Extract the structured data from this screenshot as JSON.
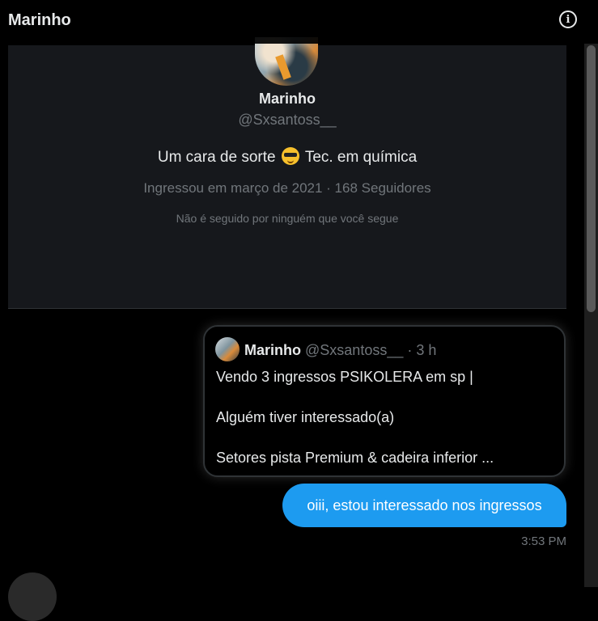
{
  "header": {
    "title": "Marinho",
    "info_icon": "info-icon"
  },
  "profile": {
    "name": "Marinho",
    "handle": "@Sxsantoss__",
    "bio_before": "Um cara de sorte",
    "bio_emoji": "smiling-face-with-sunglasses",
    "bio_after": "Tec. em química",
    "meta": "Ingressou em março de 2021 · 168 Seguidores",
    "follow_note": "Não é seguido por ninguém que você segue"
  },
  "quoted_post": {
    "name": "Marinho",
    "handle": "@Sxsantoss__",
    "separator": "·",
    "time": "3 h",
    "lines": [
      "Vendo 3 ingressos PSIKOLERA em sp |",
      "Alguém tiver interessado(a)",
      "Setores pista Premium & cadeira inferior ..."
    ]
  },
  "message": {
    "text": "oiii, estou interessado nos ingressos",
    "time": "3:53 PM"
  },
  "colors": {
    "accent": "#1d9bf0",
    "background": "#000000",
    "card": "#16181c",
    "muted_text": "#71767b"
  }
}
